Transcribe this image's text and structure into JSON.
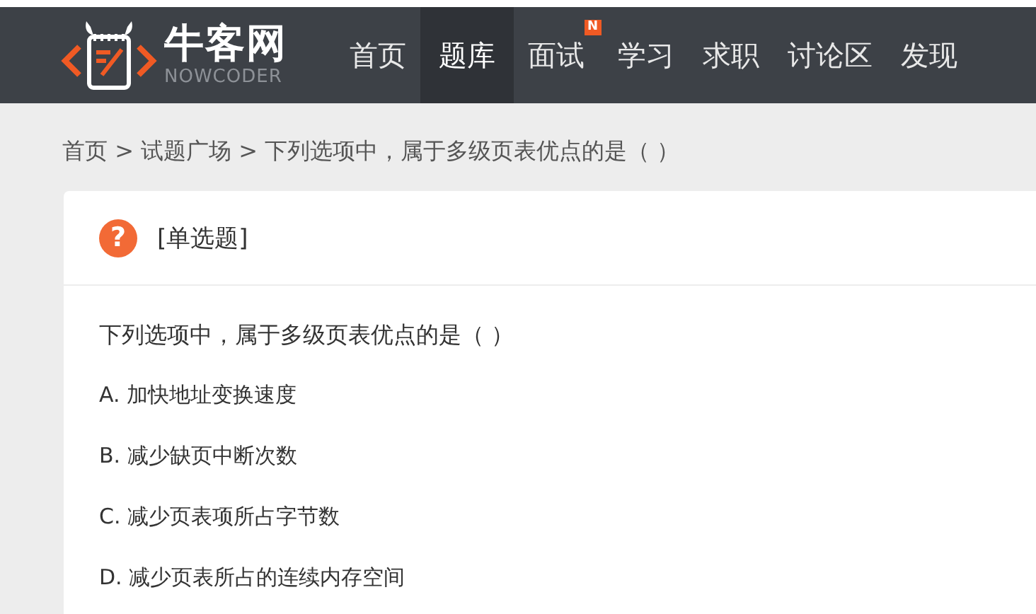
{
  "header": {
    "logo": {
      "name": "牛客网",
      "subtitle": "NOWCODER"
    },
    "nav": [
      {
        "label": "首页",
        "selected": false
      },
      {
        "label": "题库",
        "selected": true
      },
      {
        "label": "面试",
        "selected": false,
        "badge": "N"
      },
      {
        "label": "学习",
        "selected": false
      },
      {
        "label": "求职",
        "selected": false
      },
      {
        "label": "讨论区",
        "selected": false
      },
      {
        "label": "发现",
        "selected": false
      }
    ]
  },
  "breadcrumb": "首页 > 试题广场 > 下列选项中，属于多级页表优点的是（ ）",
  "question": {
    "icon": "?",
    "type": "[单选题]",
    "text": "下列选项中，属于多级页表优点的是（ ）",
    "options": [
      {
        "letter": "A.",
        "text": "加快地址变换速度"
      },
      {
        "letter": "B.",
        "text": "减少缺页中断次数"
      },
      {
        "letter": "C.",
        "text": "减少页表项所占字节数"
      },
      {
        "letter": "D.",
        "text": "减少页表所占的连续内存空间"
      }
    ]
  }
}
